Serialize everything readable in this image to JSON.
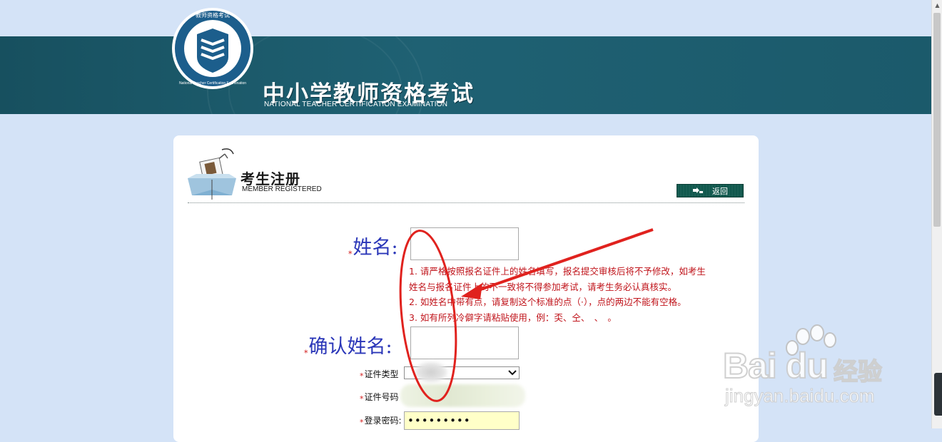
{
  "header": {
    "site_title": "中小学教师资格考试",
    "site_subtitle": "NATIONAL TEACHER CERTIFICATION EXAMINATION",
    "seal_text_top": "教师资格考试",
    "seal_text_ring": "National Teacher Certification Examination",
    "icon": "book-shield-logo-icon"
  },
  "panel": {
    "title": "考生注册",
    "subtitle": "MEMBER REGISTERED",
    "back_label": "返回",
    "back_icon": "back-arrow-icon"
  },
  "form": {
    "required_mark": "*",
    "name_label": "姓名:",
    "name_value": "",
    "confirm_name_label": "确认姓名:",
    "confirm_name_value": "",
    "id_type_label": "证件类型",
    "id_number_label": "证件号码",
    "password_label": "登录密码:",
    "password_value": "•••••••••"
  },
  "notes": [
    "1. 请严格按照报名证件上的姓名填写，报名提交审核后将不予修改，如考生",
    "姓名与报名证件上的不一致将不得参加考试，请考生务必认真核实。",
    "2. 如姓名中带有点，请复制这个标准的点（·），点的两边不能有空格。",
    "3. 如有所列冷僻字请粘贴使用，例：奀、仝、　、　。"
  ],
  "watermark": {
    "brand": "Bai du",
    "brand_cn": "经验",
    "url": "jingyan.baidu.com"
  },
  "colors": {
    "header_band": "#1b5a6b",
    "page_bg": "#d4e3f7",
    "label_blue": "#2a36b8",
    "note_red": "#c0141b",
    "annotation_red": "#e0221e",
    "back_button": "#10584d"
  }
}
